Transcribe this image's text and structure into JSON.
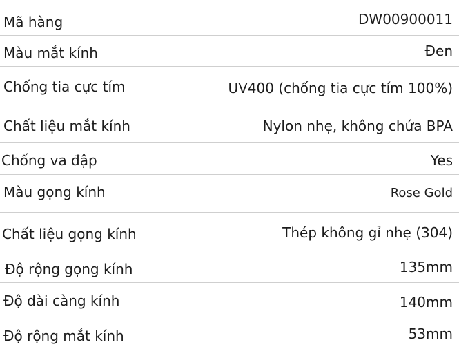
{
  "specs": [
    {
      "label": "Mã hàng",
      "value": "DW00900011"
    },
    {
      "label": "Màu mắt kính",
      "value": "Đen"
    },
    {
      "label": "Chống tia cực tím",
      "value": "UV400 (chống tia cực tím 100%)"
    },
    {
      "label": "Chất liệu mắt kính",
      "value": "Nylon nhẹ, không chứa BPA"
    },
    {
      "label": "Chống va đập",
      "value": "Yes"
    },
    {
      "label": "Màu gọng kính",
      "value": "Rose Gold"
    },
    {
      "label": "Chất liệu gọng kính",
      "value": "Thép không gỉ nhẹ (304)"
    },
    {
      "label": "Độ rộng gọng kính",
      "value": "135mm"
    },
    {
      "label": "Độ dài càng kính",
      "value": "140mm"
    },
    {
      "label": "Độ rộng mắt kính",
      "value": "53mm"
    }
  ]
}
